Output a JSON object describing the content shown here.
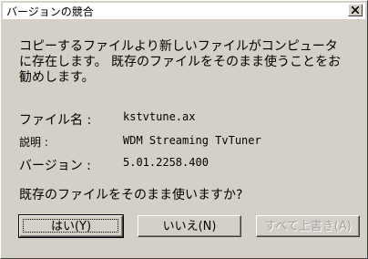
{
  "title": "バージョンの競合",
  "message": "コピーするファイルより新しいファイルがコンピュータ\nに存在します。 既存のファイルをそのまま使うことをお\n勧めします。",
  "file_label": "ファイル名 :",
  "file_value": "kstvtune.ax",
  "desc_label": "説明 :",
  "desc_value": "WDM Streaming TvTuner",
  "version_label": "バージョン :",
  "version_value": "5.01.2258.400",
  "question": "既存のファイルをそのまま使いますか?",
  "buttons": {
    "yes": "はい(Y)",
    "no": "いいえ(N)",
    "overwrite_all": "すべて上書き(A)"
  }
}
